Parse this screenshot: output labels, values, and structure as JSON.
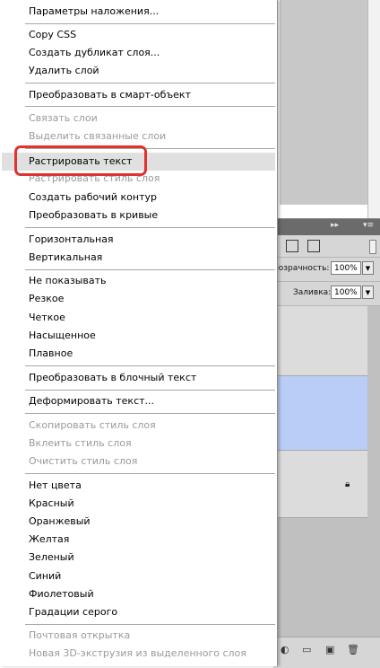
{
  "context_menu": {
    "items": [
      "Параметры наложения...",
      "Copy CSS",
      "Создать дубликат слоя...",
      "Удалить слой",
      "Преобразовать в смарт-объект",
      "Связать слои",
      "Выделить связанные слои",
      "Растрировать текст",
      "Растрировать стиль слоя",
      "Создать рабочий контур",
      "Преобразовать в кривые",
      "Горизонтальная",
      "Вертикальная",
      "Не показывать",
      "Резкое",
      "Четкое",
      "Насыщенное",
      "Плавное",
      "Преобразовать в блочный текст",
      "Деформировать текст...",
      "Скопировать стиль слоя",
      "Вклеить стиль слоя",
      "Очистить стиль слоя",
      "Нет цвета",
      "Красный",
      "Оранжевый",
      "Желтая",
      "Зеленый",
      "Синий",
      "Фиолетовый",
      "Градации серого",
      "Почтовая открытка",
      "Новая 3D-экструзия из выделенного слоя"
    ],
    "highlighted_item": "Растрировать текст",
    "highlight_color": "#e0322e"
  },
  "layers_panel": {
    "tab_controls": [
      "▸▸",
      "▾≡"
    ],
    "opacity_label": "Непрозрачность:",
    "opacity_visible_label": "розрачность:",
    "opacity_value": "100%",
    "fill_label": "Заливка:",
    "fill_value": "100%",
    "selected_layer_color": "#b9cdf7"
  }
}
